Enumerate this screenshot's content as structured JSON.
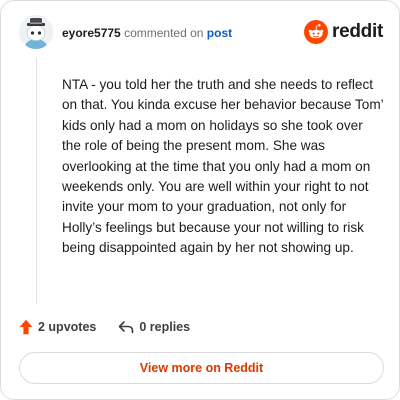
{
  "header": {
    "username": "eyore5775",
    "action_text": "commented on",
    "target_link": "post",
    "brand_name": "reddit",
    "avatar_icon": "snoo-avatar-icon",
    "logo_icon": "reddit-logo-icon"
  },
  "comment": {
    "body": "NTA - you told her the truth and she needs to reflect on that. You kinda excuse her behavior because Tom’ kids only had a mom on holidays so she took over the role of being the present mom. She was overlooking at the time that you only had a mom on weekends only. You are well within your right to not invite your mom to your graduation, not only for Holly’s feelings but because your not willing to risk being disappointed again by her not showing up."
  },
  "actions": {
    "upvotes_label": "2 upvotes",
    "replies_label": "0 replies",
    "upvote_icon": "upvote-arrow-icon",
    "reply_icon": "reply-icon"
  },
  "footer": {
    "view_button_label": "View more on Reddit"
  },
  "colors": {
    "brand_orange": "#ff4500",
    "link_blue": "#0a5dc2",
    "button_text": "#d93a00"
  }
}
